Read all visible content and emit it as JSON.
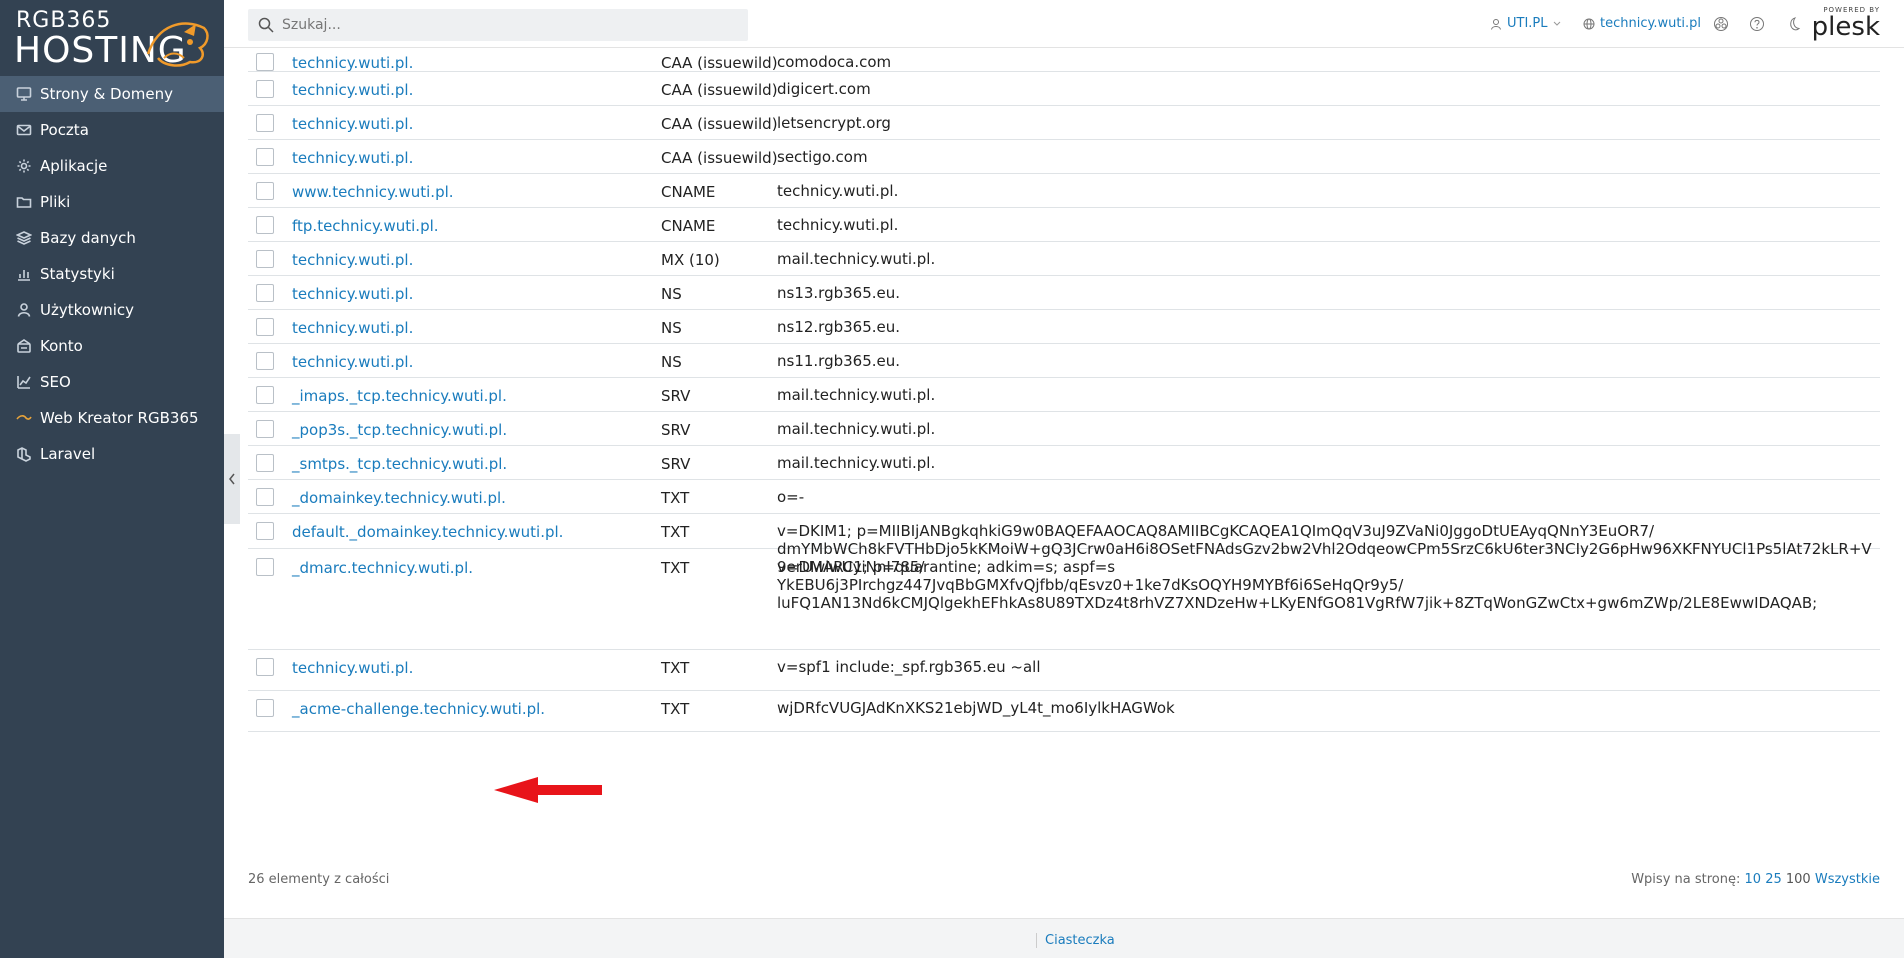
{
  "logo": {
    "line1": "RGB365",
    "line2": "HOSTING"
  },
  "sidebar": {
    "items": [
      {
        "label": "Strony & Domeny",
        "icon": "monitor-icon",
        "active": true
      },
      {
        "label": "Poczta",
        "icon": "envelope-icon"
      },
      {
        "label": "Aplikacje",
        "icon": "gear-icon"
      },
      {
        "label": "Pliki",
        "icon": "folder-icon"
      },
      {
        "label": "Bazy danych",
        "icon": "database-layers-icon"
      },
      {
        "label": "Statystyki",
        "icon": "bar-chart-icon"
      },
      {
        "label": "Użytkownicy",
        "icon": "user-icon"
      },
      {
        "label": "Konto",
        "icon": "account-icon"
      },
      {
        "label": "SEO",
        "icon": "seo-chart-icon"
      },
      {
        "label": "Web Kreator RGB365",
        "icon": "web-kreator-icon"
      },
      {
        "label": "Laravel",
        "icon": "laravel-icon"
      }
    ]
  },
  "header": {
    "search_placeholder": "Szukaj...",
    "account": "UTI.PL",
    "domain": "technicy.wuti.pl",
    "powered_by": "POWERED BY",
    "brand": "plesk"
  },
  "records": [
    {
      "host": "technicy.wuti.pl.",
      "type": "CAA (issuewild)",
      "value": "comodoca.com"
    },
    {
      "host": "technicy.wuti.pl.",
      "type": "CAA (issuewild)",
      "value": "digicert.com"
    },
    {
      "host": "technicy.wuti.pl.",
      "type": "CAA (issuewild)",
      "value": "letsencrypt.org"
    },
    {
      "host": "technicy.wuti.pl.",
      "type": "CAA (issuewild)",
      "value": "sectigo.com"
    },
    {
      "host": "www.technicy.wuti.pl.",
      "type": "CNAME",
      "value": "technicy.wuti.pl."
    },
    {
      "host": "ftp.technicy.wuti.pl.",
      "type": "CNAME",
      "value": "technicy.wuti.pl."
    },
    {
      "host": "technicy.wuti.pl.",
      "type": "MX (10)",
      "value": "mail.technicy.wuti.pl."
    },
    {
      "host": "technicy.wuti.pl.",
      "type": "NS",
      "value": "ns13.rgb365.eu."
    },
    {
      "host": "technicy.wuti.pl.",
      "type": "NS",
      "value": "ns12.rgb365.eu."
    },
    {
      "host": "technicy.wuti.pl.",
      "type": "NS",
      "value": "ns11.rgb365.eu."
    },
    {
      "host": "_imaps._tcp.technicy.wuti.pl.",
      "type": "SRV",
      "value": "mail.technicy.wuti.pl."
    },
    {
      "host": "_pop3s._tcp.technicy.wuti.pl.",
      "type": "SRV",
      "value": "mail.technicy.wuti.pl."
    },
    {
      "host": "_smtps._tcp.technicy.wuti.pl.",
      "type": "SRV",
      "value": "mail.technicy.wuti.pl."
    },
    {
      "host": "_domainkey.technicy.wuti.pl.",
      "type": "TXT",
      "value": "o=-"
    },
    {
      "host": "default._domainkey.technicy.wuti.pl.",
      "type": "TXT",
      "value": "v=DKIM1; p=MIIBIjANBgkqhkiG9w0BAQEFAAOCAQ8AMIIBCgKCAQEA1QImQqV3uJ9ZVaNi0JggoDtUEAyqQNnY3EuOR7/\ndmYMbWCh8kFVTHbDjo5kKMoiW+gQ3JCrw0aH6i8OSetFNAdsGzv2bw2Vhl2OdqeowCPm5SrzC6kU6ter3NCIy2G6pHw96XKFNYUCl1Ps5lAt72kLR+V9erUwiwUyiNnI785/\nYkEBU6j3PIrchgz447JvqBbGMXfvQjfbb/qEsvz0+1ke7dKsOQYH9MYBf6i6SeHqQr9y5/\nluFQ1AN13Nd6kCMJQlgekhEFhkAs8U89TXDz4t8rhVZ7XNDzeHw+LKyENfGO81VgRfW7jik+8ZTqWonGZwCtx+gw6mZWp/2LE8EwwIDAQAB;"
    },
    {
      "host": "_dmarc.technicy.wuti.pl.",
      "type": "TXT",
      "value": "v=DMARC1; p=quarantine; adkim=s; aspf=s"
    },
    {
      "host": "technicy.wuti.pl.",
      "type": "TXT",
      "value": "v=spf1 include:_spf.rgb365.eu ~all"
    },
    {
      "host": "_acme-challenge.technicy.wuti.pl.",
      "type": "TXT",
      "value": "wjDRfcVUGJAdKnXKS21ebjWD_yL4t_mo6IylkHAGWok"
    }
  ],
  "footer": {
    "count": "26 elementy z całości",
    "perpage_label": "Wpisy na stronę:",
    "opt10": "10",
    "opt25": "25",
    "opt100": "100",
    "opt_all": "Wszystkie"
  },
  "bottom": {
    "cookies": "Ciasteczka"
  },
  "colors": {
    "sidebar": "#334252",
    "active": "#4b5f74",
    "link": "#1a7cbd",
    "arrow": "#e8141a"
  }
}
